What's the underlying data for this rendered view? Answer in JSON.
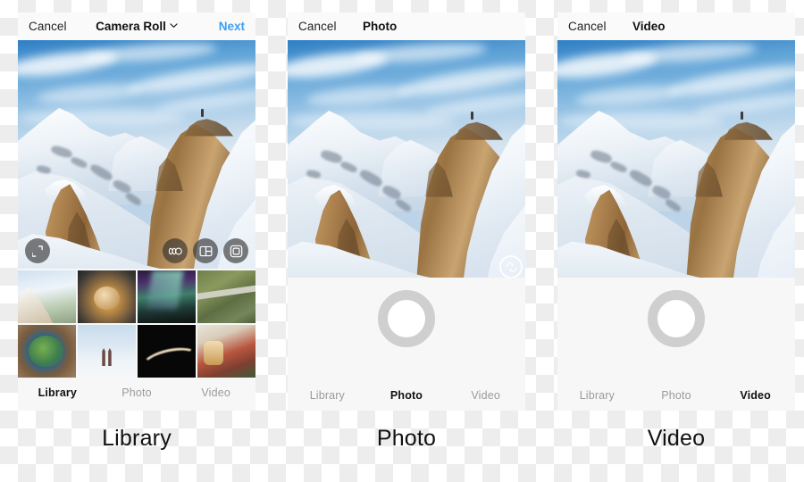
{
  "panels": [
    {
      "id": "library",
      "nav": {
        "cancel_label": "Cancel",
        "title": "Camera Roll",
        "chevron_icon": "chevron-down-icon",
        "next_label": "Next"
      },
      "hero": {
        "alt": "snowy mountain peak with rocky outcrops under blue sky",
        "overlay_buttons": [
          {
            "name": "expand-icon",
            "label": "Expand"
          },
          {
            "name": "infinity-icon",
            "label": "Boomerang"
          },
          {
            "name": "layout-icon",
            "label": "Layout"
          },
          {
            "name": "multi-select-icon",
            "label": "Select Multiple"
          }
        ]
      },
      "thumbnails": [
        {
          "name": "thumb-mountain",
          "alt": "snowy mountain ridge"
        },
        {
          "name": "thumb-food",
          "alt": "fried food on a plate"
        },
        {
          "name": "thumb-aurora",
          "alt": "aurora over pine trees"
        },
        {
          "name": "thumb-aerial-path",
          "alt": "aerial view of path through field"
        },
        {
          "name": "thumb-salad",
          "alt": "salad bowl on wooden table"
        },
        {
          "name": "thumb-bridge",
          "alt": "bridge tower above fog"
        },
        {
          "name": "thumb-light-trails",
          "alt": "light trails on dark road"
        },
        {
          "name": "thumb-holiday-drinks",
          "alt": "holiday drinks with decorations"
        }
      ],
      "tabs": [
        {
          "label": "Library",
          "active": true
        },
        {
          "label": "Photo",
          "active": false
        },
        {
          "label": "Video",
          "active": false
        }
      ],
      "caption": "Library"
    },
    {
      "id": "photo",
      "nav": {
        "cancel_label": "Cancel",
        "title": "Photo",
        "next_label": ""
      },
      "hero": {
        "alt": "snowy mountain peak with rocky outcrops under blue sky",
        "overlay_buttons": [
          {
            "name": "camera-flip-icon",
            "label": "Switch Camera"
          }
        ]
      },
      "shutter": {
        "name": "shutter-button",
        "label": "Capture Photo"
      },
      "tabs": [
        {
          "label": "Library",
          "active": false
        },
        {
          "label": "Photo",
          "active": true
        },
        {
          "label": "Video",
          "active": false
        }
      ],
      "caption": "Photo"
    },
    {
      "id": "video",
      "nav": {
        "cancel_label": "Cancel",
        "title": "Video",
        "next_label": ""
      },
      "hero": {
        "alt": "snowy mountain peak with rocky outcrops under blue sky",
        "overlay_buttons": []
      },
      "shutter": {
        "name": "record-button",
        "label": "Record Video"
      },
      "tabs": [
        {
          "label": "Library",
          "active": false
        },
        {
          "label": "Photo",
          "active": false
        },
        {
          "label": "Video",
          "active": true
        }
      ],
      "caption": "Video"
    }
  ],
  "colors": {
    "accent_blue": "#3e9ef0",
    "panel_background": "#f7f7f7",
    "navbar_background": "#fafafa",
    "active_tab": "#111111",
    "inactive_tab": "#9b9b9b",
    "shutter_ring": "#cfcfcf"
  }
}
